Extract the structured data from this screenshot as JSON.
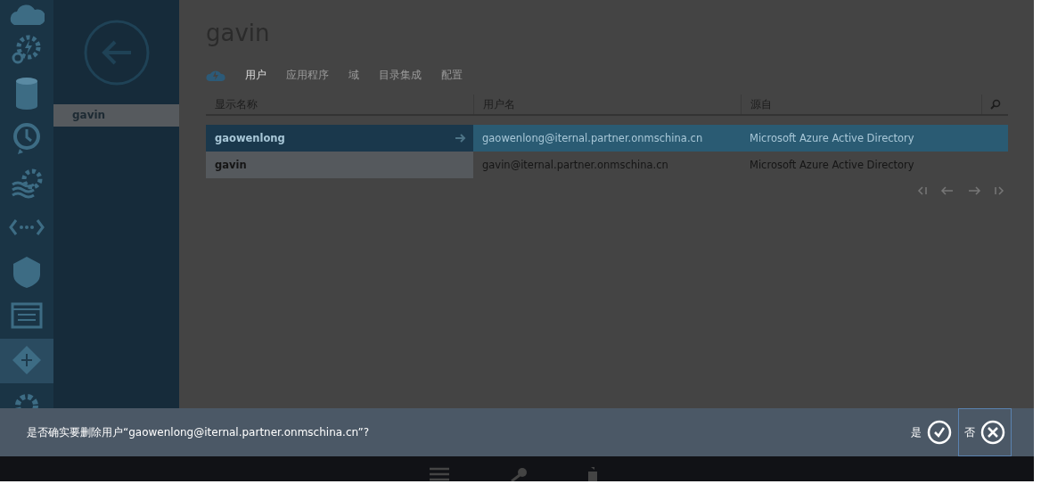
{
  "nav": {
    "items": [
      {
        "kind": "cloud",
        "selected": false
      },
      {
        "kind": "gears",
        "selected": false
      },
      {
        "kind": "database",
        "selected": false
      },
      {
        "kind": "clock",
        "selected": false
      },
      {
        "kind": "waves",
        "selected": false
      },
      {
        "kind": "code",
        "selected": false
      },
      {
        "kind": "shield",
        "selected": false
      },
      {
        "kind": "grid",
        "selected": false
      },
      {
        "kind": "diamond",
        "selected": true
      },
      {
        "kind": "gear",
        "selected": false
      }
    ]
  },
  "directory_list": {
    "items": [
      {
        "label": "gavin",
        "selected": true
      }
    ]
  },
  "page": {
    "title": "gavin",
    "tabs": [
      {
        "label": "用户",
        "selected": true
      },
      {
        "label": "应用程序",
        "selected": false
      },
      {
        "label": "域",
        "selected": false
      },
      {
        "label": "目录集成",
        "selected": false
      },
      {
        "label": "配置",
        "selected": false
      }
    ]
  },
  "table": {
    "columns": [
      "显示名称",
      "用户名",
      "源自"
    ],
    "rows": [
      {
        "cells": [
          "gaowenlong",
          "gaowenlong@iternal.partner.onmschina.cn",
          "Microsoft Azure Active Directory"
        ],
        "selected": true
      },
      {
        "cells": [
          "gavin",
          "gavin@iternal.partner.onmschina.cn",
          "Microsoft Azure Active Directory"
        ],
        "selected": false
      }
    ]
  },
  "dialog": {
    "message": "是否确实要删除用户“gaowenlong@iternal.partner.onmschina.cn”?",
    "buttons": [
      {
        "label": "是",
        "kind": "yes",
        "focused": false
      },
      {
        "label": "否",
        "kind": "no",
        "focused": true
      }
    ]
  }
}
